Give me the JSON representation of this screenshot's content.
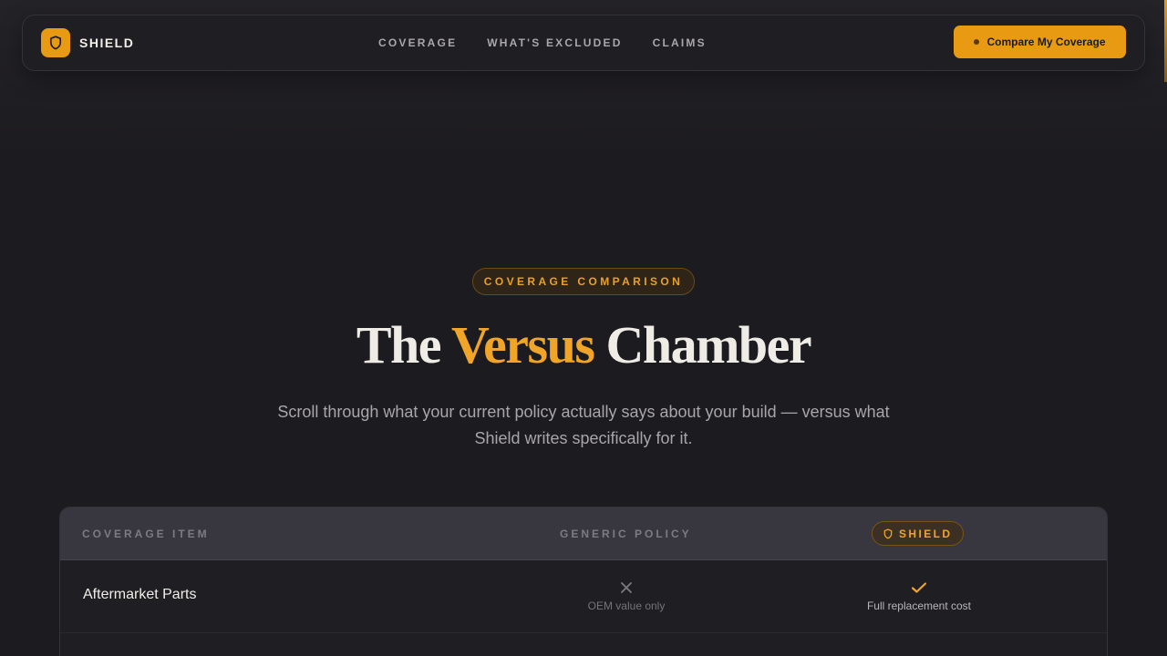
{
  "brand": {
    "name": "SHIELD",
    "logo_icon": "shield-icon",
    "accent": "#e89a12"
  },
  "nav": {
    "links": [
      "COVERAGE",
      "WHAT'S EXCLUDED",
      "CLAIMS"
    ]
  },
  "cta": {
    "label": "Compare My Coverage"
  },
  "hero": {
    "eyebrow": "COVERAGE COMPARISON",
    "title_before": "The ",
    "title_accent": "Versus",
    "title_after": " Chamber",
    "subtitle": "Scroll through what your current policy actually says about your build — versus what Shield writes specifically for it."
  },
  "table": {
    "headers": {
      "item": "COVERAGE ITEM",
      "generic": "GENERIC POLICY",
      "shield": "SHIELD"
    },
    "rows": [
      {
        "label": "Aftermarket Parts",
        "generic_icon": "x-icon",
        "generic_note": "OEM value only",
        "shield_icon": "check-icon",
        "shield_note": "Full replacement cost"
      }
    ]
  }
}
